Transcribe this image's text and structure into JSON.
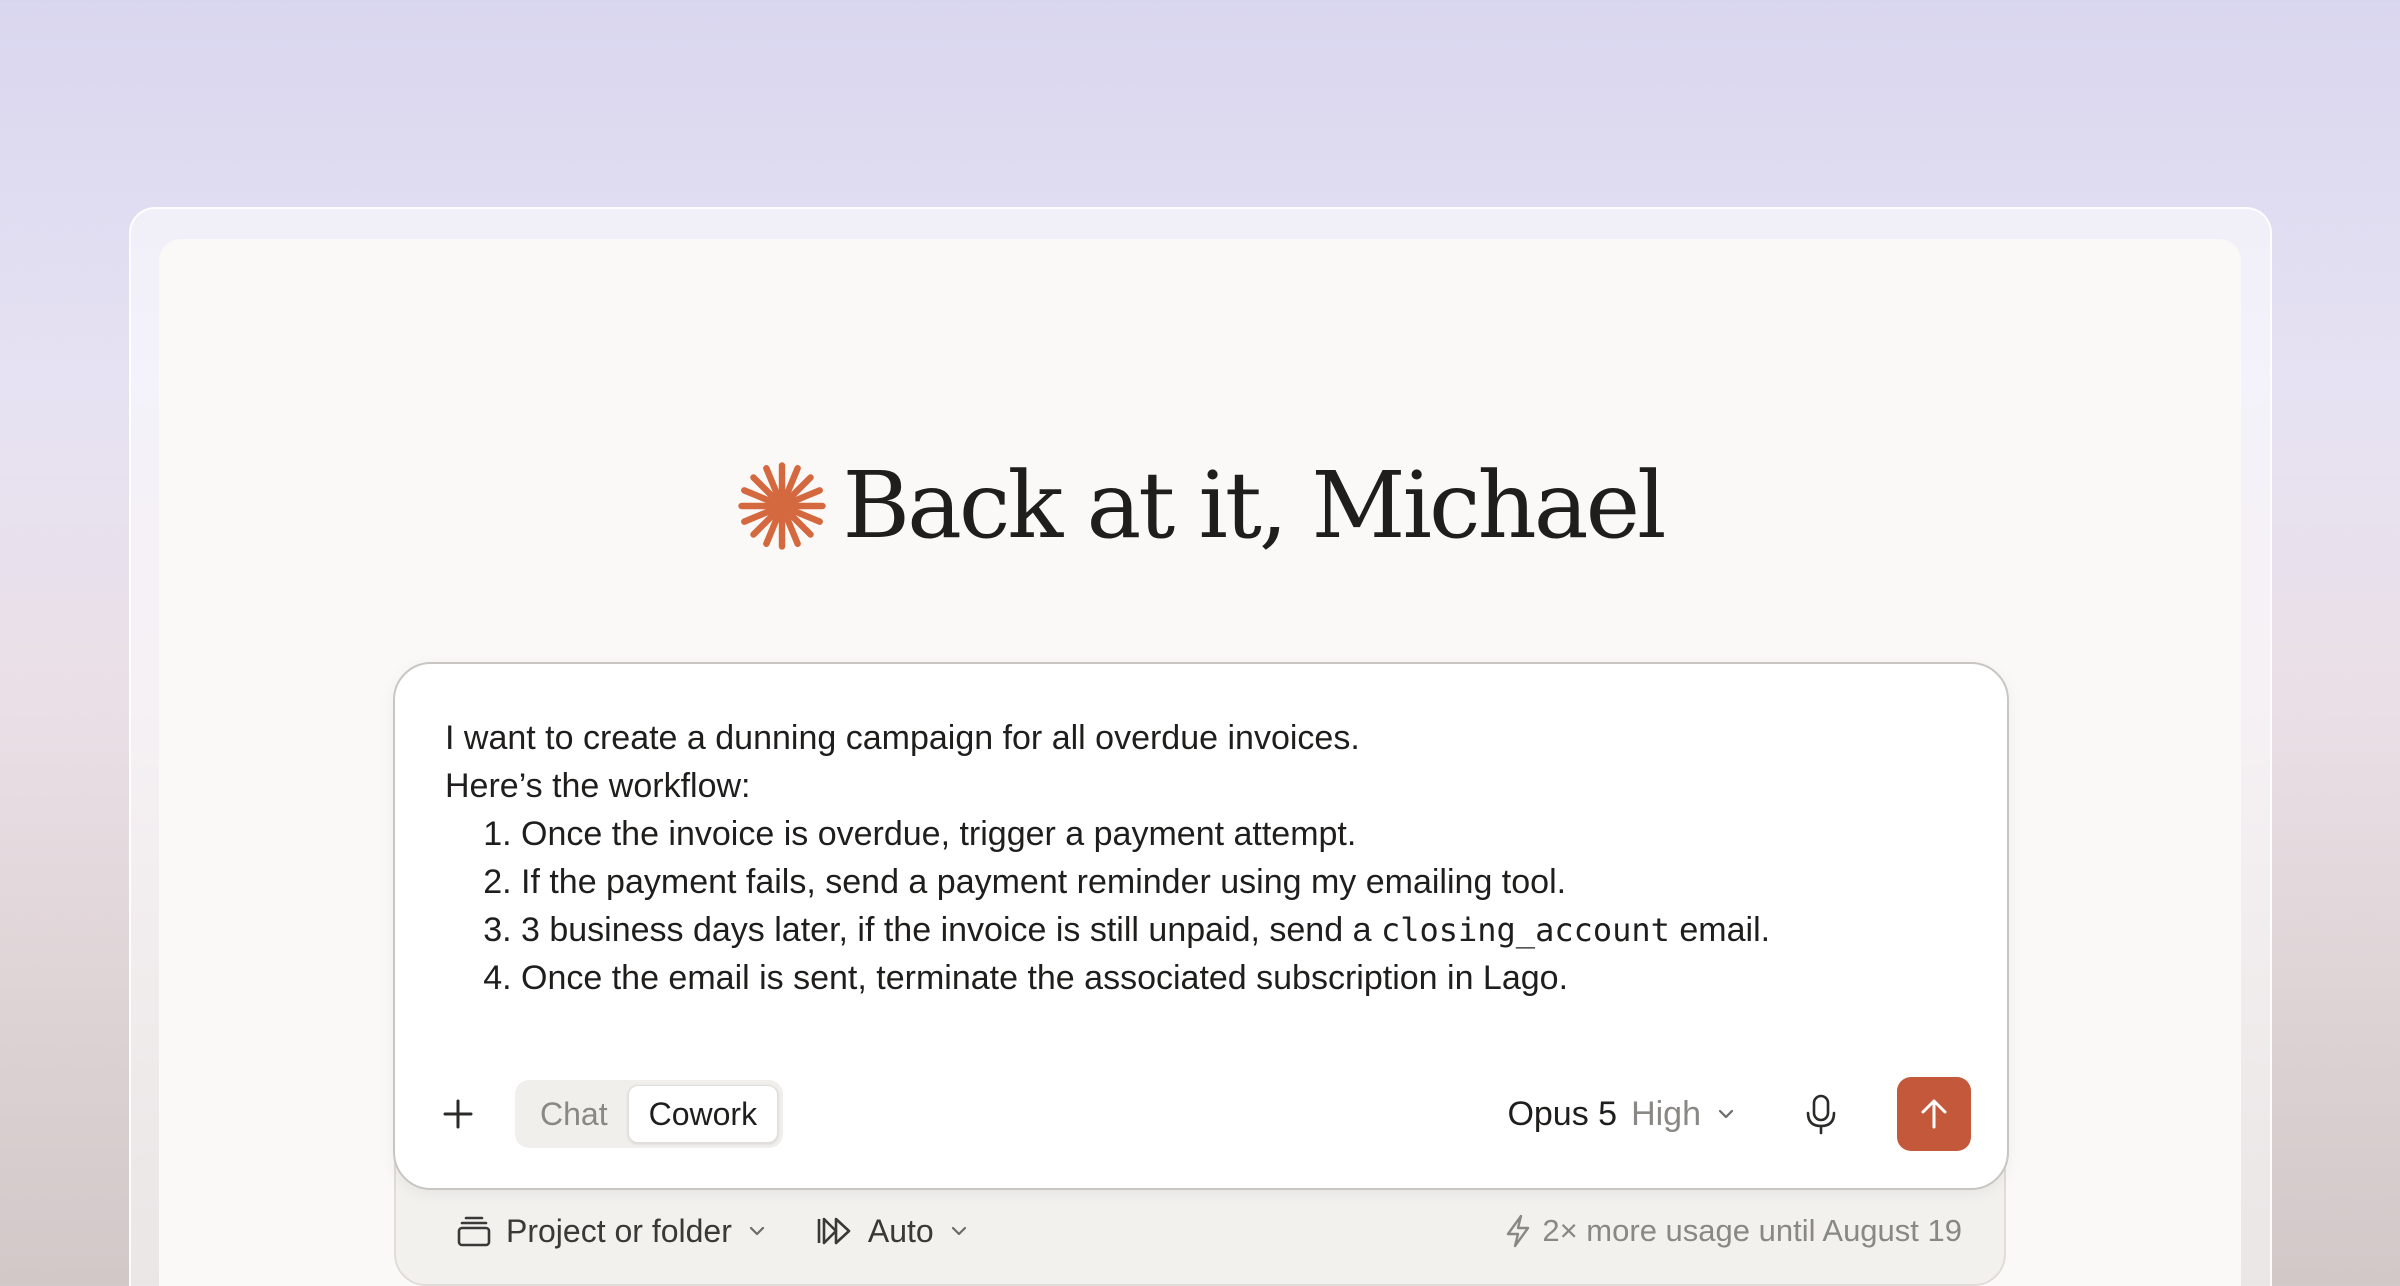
{
  "greeting": {
    "text": "Back at it, Michael",
    "icon": "sparkle-logo-icon",
    "icon_color": "#d4693f"
  },
  "composer": {
    "intro_line1": "I want to create a dunning campaign for all overdue invoices.",
    "intro_line2": "Here’s the workflow:",
    "steps": [
      "Once the invoice is overdue, trigger a payment attempt.",
      "If the payment fails, send a payment reminder using my emailing tool.",
      {
        "before": "3 business days later, if the invoice is still unpaid, send a ",
        "code": "closing_account",
        "after": " email."
      },
      "Once the email is sent, terminate the associated subscription in Lago."
    ],
    "toolbar": {
      "add_icon": "plus-icon",
      "modes": [
        "Chat",
        "Cowork"
      ],
      "active_mode": "Cowork",
      "model_name": "Opus 5",
      "model_level": "High",
      "mic_icon": "microphone-icon",
      "send_icon": "arrow-up-icon",
      "send_color": "#c4583a"
    }
  },
  "footer": {
    "project_label": "Project or folder",
    "project_icon": "folder-stack-icon",
    "auto_label": "Auto",
    "auto_icon": "fast-forward-icon",
    "usage_note": "2× more usage until August 19",
    "usage_icon": "lightning-icon"
  }
}
